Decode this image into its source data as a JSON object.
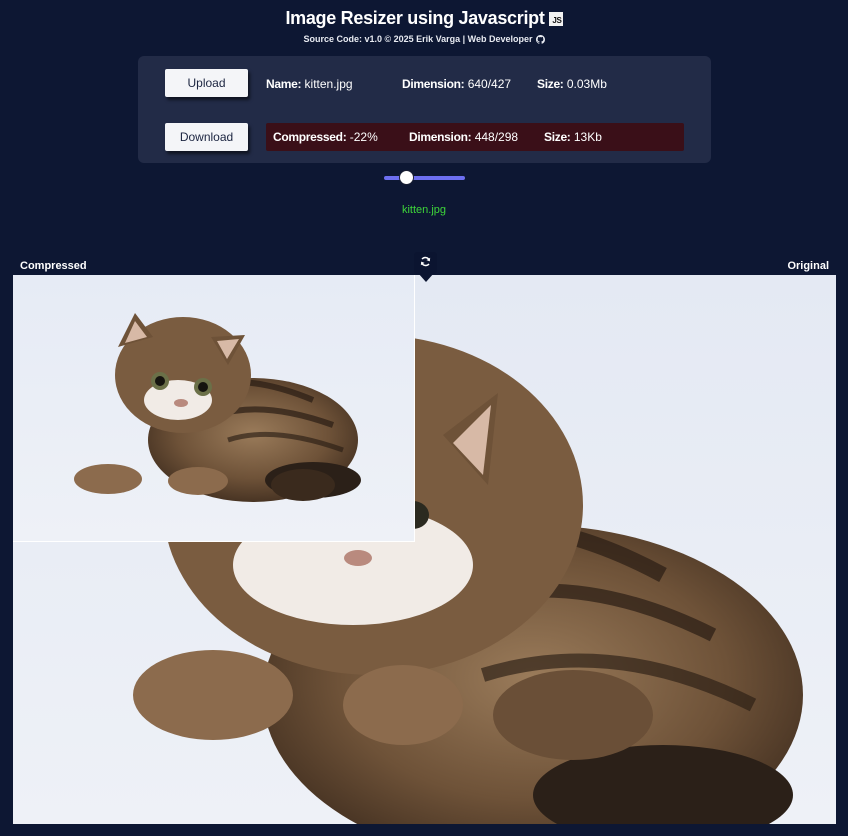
{
  "header": {
    "title": "Image Resizer using Javascript",
    "js_badge": "JS",
    "subtitle": "Source Code: v1.0  © 2025 Erik Varga | Web Developer"
  },
  "controls": {
    "upload_label": "Upload",
    "download_label": "Download"
  },
  "original_info": {
    "name_label": "Name:",
    "name_value": "kitten.jpg",
    "dimension_label": "Dimension:",
    "dimension_value": "640/427",
    "size_label": "Size:",
    "size_value": "0.03Mb"
  },
  "compressed_info": {
    "compressed_label": "Compressed:",
    "compressed_value": "-22%",
    "dimension_label": "Dimension:",
    "dimension_value": "448/298",
    "size_label": "Size:",
    "size_value": "13Kb",
    "bar_color": "#3a0f18"
  },
  "slider": {
    "value_fraction": 0.2,
    "track_color": "#6d6ff0"
  },
  "output_filename": "kitten.jpg",
  "viewer": {
    "compressed_label": "Compressed",
    "original_label": "Original",
    "swap_icon": "refresh-icon"
  },
  "colors": {
    "background": "#0d1733",
    "panel": "#222b47",
    "accent_green": "#3ed63a"
  }
}
